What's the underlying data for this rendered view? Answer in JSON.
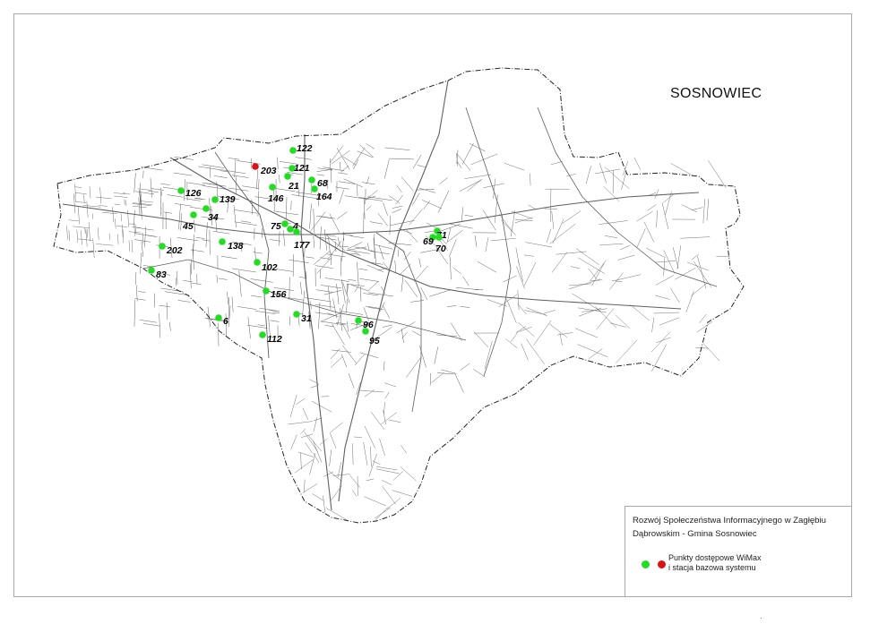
{
  "map": {
    "title": "SOSNOWIEC",
    "colors": {
      "access_point": "#22dd22",
      "base_station": "#dd1111",
      "streets": "#555555",
      "boundary": "#222222"
    },
    "points": [
      {
        "label": "122",
        "kind": "access_point"
      },
      {
        "label": "203",
        "kind": "base_station"
      },
      {
        "label": "121",
        "kind": "access_point"
      },
      {
        "label": "21",
        "kind": "access_point"
      },
      {
        "label": "68",
        "kind": "access_point"
      },
      {
        "label": "164",
        "kind": "access_point"
      },
      {
        "label": "146",
        "kind": "access_point"
      },
      {
        "label": "126",
        "kind": "access_point"
      },
      {
        "label": "139",
        "kind": "access_point"
      },
      {
        "label": "34",
        "kind": "access_point"
      },
      {
        "label": "45",
        "kind": "access_point"
      },
      {
        "label": "75",
        "kind": "access_point"
      },
      {
        "label": "4",
        "kind": "access_point"
      },
      {
        "label": "177",
        "kind": "access_point"
      },
      {
        "label": "138",
        "kind": "access_point"
      },
      {
        "label": "202",
        "kind": "access_point"
      },
      {
        "label": "83",
        "kind": "access_point"
      },
      {
        "label": "102",
        "kind": "access_point"
      },
      {
        "label": "156",
        "kind": "access_point"
      },
      {
        "label": "6",
        "kind": "access_point"
      },
      {
        "label": "31",
        "kind": "access_point"
      },
      {
        "label": "112",
        "kind": "access_point"
      },
      {
        "label": "96",
        "kind": "access_point"
      },
      {
        "label": "95",
        "kind": "access_point"
      },
      {
        "label": "71",
        "kind": "access_point"
      },
      {
        "label": "69",
        "kind": "access_point"
      },
      {
        "label": "70",
        "kind": "access_point"
      }
    ]
  },
  "legend": {
    "title": "Rozwój Społeczeństwa Informacyjnego w Zagłębiu Dąbrowskim - Gmina Sosnowiec",
    "line1": "Punkty dostępowe WiMax",
    "line2": "i stacja  bazowa systemu"
  }
}
